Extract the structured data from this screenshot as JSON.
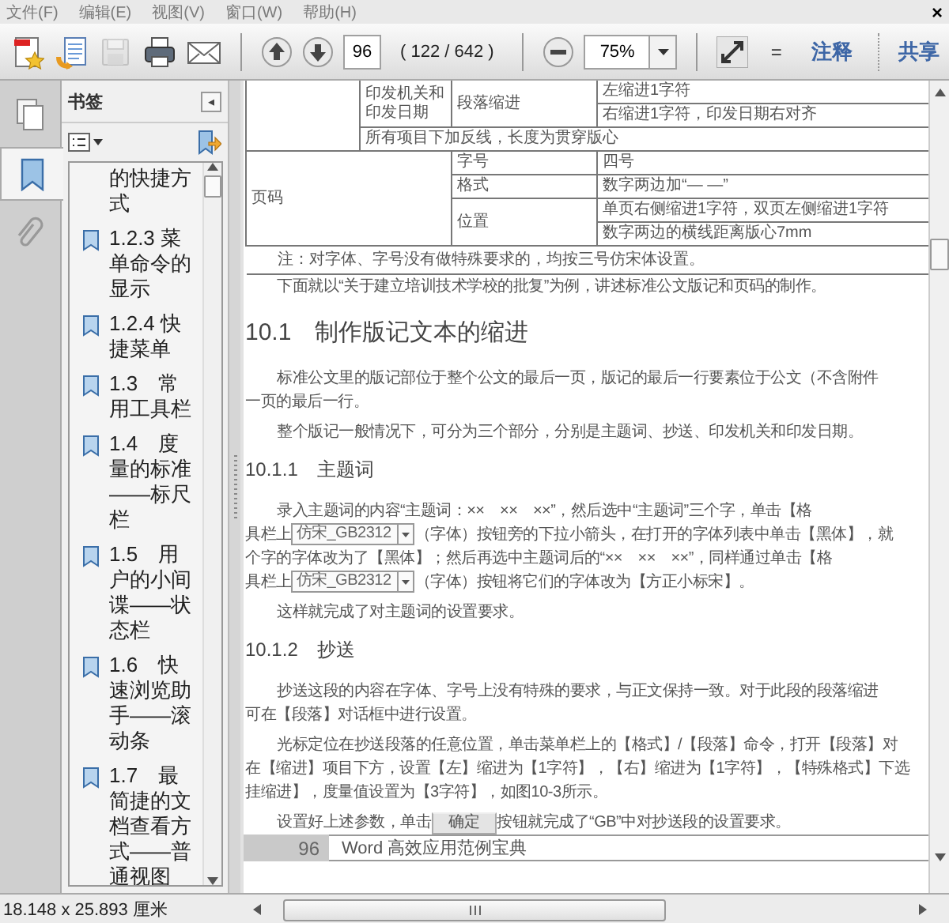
{
  "menu": {
    "items": [
      "文件(F)",
      "编辑(E)",
      "视图(V)",
      "窗口(W)",
      "帮助(H)"
    ],
    "close": "×"
  },
  "toolbar": {
    "tools": [
      {
        "disabled": false
      },
      {
        "disabled": false
      },
      {
        "disabled": true
      },
      {
        "disabled": false
      },
      {
        "disabled": false
      }
    ],
    "page": "96",
    "page_count": "( 122 / 642 )",
    "zoom": "75%",
    "menu_glyph": "=",
    "links": [
      "注释",
      "共享"
    ]
  },
  "sidebar": {
    "tabs": [
      {
        "selected": false
      },
      {
        "selected": true
      },
      {
        "selected": false
      }
    ],
    "title": "书签",
    "collapse": "◂",
    "bookmarks": [
      {
        "kind": "continuation",
        "text": "的快捷方式"
      },
      {
        "kind": "bookmark",
        "text": "1.2.3 菜单命令的显示"
      },
      {
        "kind": "bookmark",
        "text": "1.2.4 快捷菜单"
      },
      {
        "kind": "bookmark",
        "text": "1.3　常用工具栏"
      },
      {
        "kind": "bookmark",
        "text": "1.4　度量的标准——标尺栏"
      },
      {
        "kind": "bookmark",
        "text": "1.5　用户的小间谍——状态栏"
      },
      {
        "kind": "bookmark",
        "text": "1.6　快速浏览助手——滚动条"
      },
      {
        "kind": "bookmark",
        "text": "1.7　最简捷的文档查看方式——普通视图"
      }
    ]
  },
  "document": {
    "table": {
      "rows": [
        [
          {
            "rowspan": 3
          },
          {
            "text": "印发机关和印发日期",
            "rowspan": 2
          },
          {
            "text": "段落缩进",
            "rowspan": 2
          },
          {
            "text": "左缩进1字符"
          }
        ],
        [
          {
            "text": "右缩进1字符，印发日期右对齐"
          }
        ],
        [
          {
            "text": "所有项目下加反线，长度为贯穿版心",
            "colspan": 3
          }
        ],
        [
          {
            "text": "页码",
            "colspan": 2,
            "rowspan": 4
          },
          {
            "text": "字号"
          },
          {
            "text": "四号"
          }
        ],
        [
          {
            "text": "格式"
          },
          {
            "text": "数字两边加“— —”"
          }
        ],
        [
          {
            "text": "位置",
            "rowspan": 2
          },
          {
            "text": "单页右侧缩进1字符，双页左侧缩进1字符"
          }
        ],
        [
          {
            "text": "数字两边的横线距离版心7mm"
          }
        ],
        [
          {
            "text": "注：对字体、字号没有做特殊要求的，均按三号仿宋体设置。",
            "colspan": 4
          }
        ]
      ]
    },
    "blocks": [
      {
        "kind": "paragraph",
        "lines": [
          [
            {
              "kind": "text",
              "text": "下面就以“关于建立培训技术学校的批复”为例，讲述标准公文版记和页码的制作。"
            }
          ]
        ]
      },
      {
        "kind": "h1",
        "text": "10.1　制作版记文本的缩进"
      },
      {
        "kind": "paragraph",
        "lines": [
          [
            {
              "kind": "text",
              "text": "标准公文里的版记部位于整个公文的最后一页，版记的最后一行要素位于公文（不含附件"
            }
          ],
          [
            {
              "kind": "text",
              "text": "一页的最后一行。"
            }
          ]
        ]
      },
      {
        "kind": "paragraph",
        "lines": [
          [
            {
              "kind": "text",
              "text": "整个版记一般情况下，可分为三个部分，分别是主题词、抄送、印发机关和印发日期。"
            }
          ]
        ]
      },
      {
        "kind": "h2",
        "text": "10.1.1　主题词"
      },
      {
        "kind": "paragraph",
        "lines": [
          [
            {
              "kind": "text",
              "text": "录入主题词的内容“主题词：××　××　××”，然后选中“主题词”三个字，单击【格"
            }
          ],
          [
            {
              "kind": "text",
              "text": "具栏上"
            },
            {
              "kind": "combo",
              "text": "仿宋_GB2312"
            },
            {
              "kind": "text",
              "text": "（字体）按钮旁的下拉小箭头，在打开的字体列表中单击【黑体】，就"
            }
          ],
          [
            {
              "kind": "text",
              "text": "个字的字体改为了【黑体】；然后再选中主题词后的“××　××　××”，同样通过单击【格"
            }
          ],
          [
            {
              "kind": "text",
              "text": "具栏上"
            },
            {
              "kind": "combo",
              "text": "仿宋_GB2312"
            },
            {
              "kind": "text",
              "text": "（字体）按钮将它们的字体改为【方正小标宋】。"
            }
          ]
        ]
      },
      {
        "kind": "paragraph",
        "lines": [
          [
            {
              "kind": "text",
              "text": "这样就完成了对主题词的设置要求。"
            }
          ]
        ]
      },
      {
        "kind": "h2",
        "text": "10.1.2　抄送"
      },
      {
        "kind": "paragraph",
        "lines": [
          [
            {
              "kind": "text",
              "text": "抄送这段的内容在字体、字号上没有特殊的要求，与正文保持一致。对于此段的段落缩进"
            }
          ],
          [
            {
              "kind": "text",
              "text": "可在【段落】对话框中进行设置。"
            }
          ]
        ]
      },
      {
        "kind": "paragraph",
        "lines": [
          [
            {
              "kind": "text",
              "text": "光标定位在抄送段落的任意位置，单击菜单栏上的【格式】/【段落】命令，打开【段落】对"
            }
          ],
          [
            {
              "kind": "text",
              "text": "在【缩进】项目下方，设置【左】缩进为【1字符】，【右】缩进为【1字符】，【特殊格式】下选"
            }
          ],
          [
            {
              "kind": "text",
              "text": "挂缩进】，度量值设置为【3字符】，如图10-3所示。"
            }
          ]
        ]
      },
      {
        "kind": "paragraph",
        "lines": [
          [
            {
              "kind": "text",
              "text": "设置好上述参数，单击"
            },
            {
              "kind": "button",
              "text": "确定"
            },
            {
              "kind": "text",
              "text": "按钮就完成了“GB”中对抄送段的设置要求。"
            }
          ]
        ]
      }
    ],
    "footer": {
      "page_number": "96",
      "title": "Word 高效应用范例宝典"
    }
  },
  "status": {
    "size": "18.148 x 25.893 厘米"
  }
}
